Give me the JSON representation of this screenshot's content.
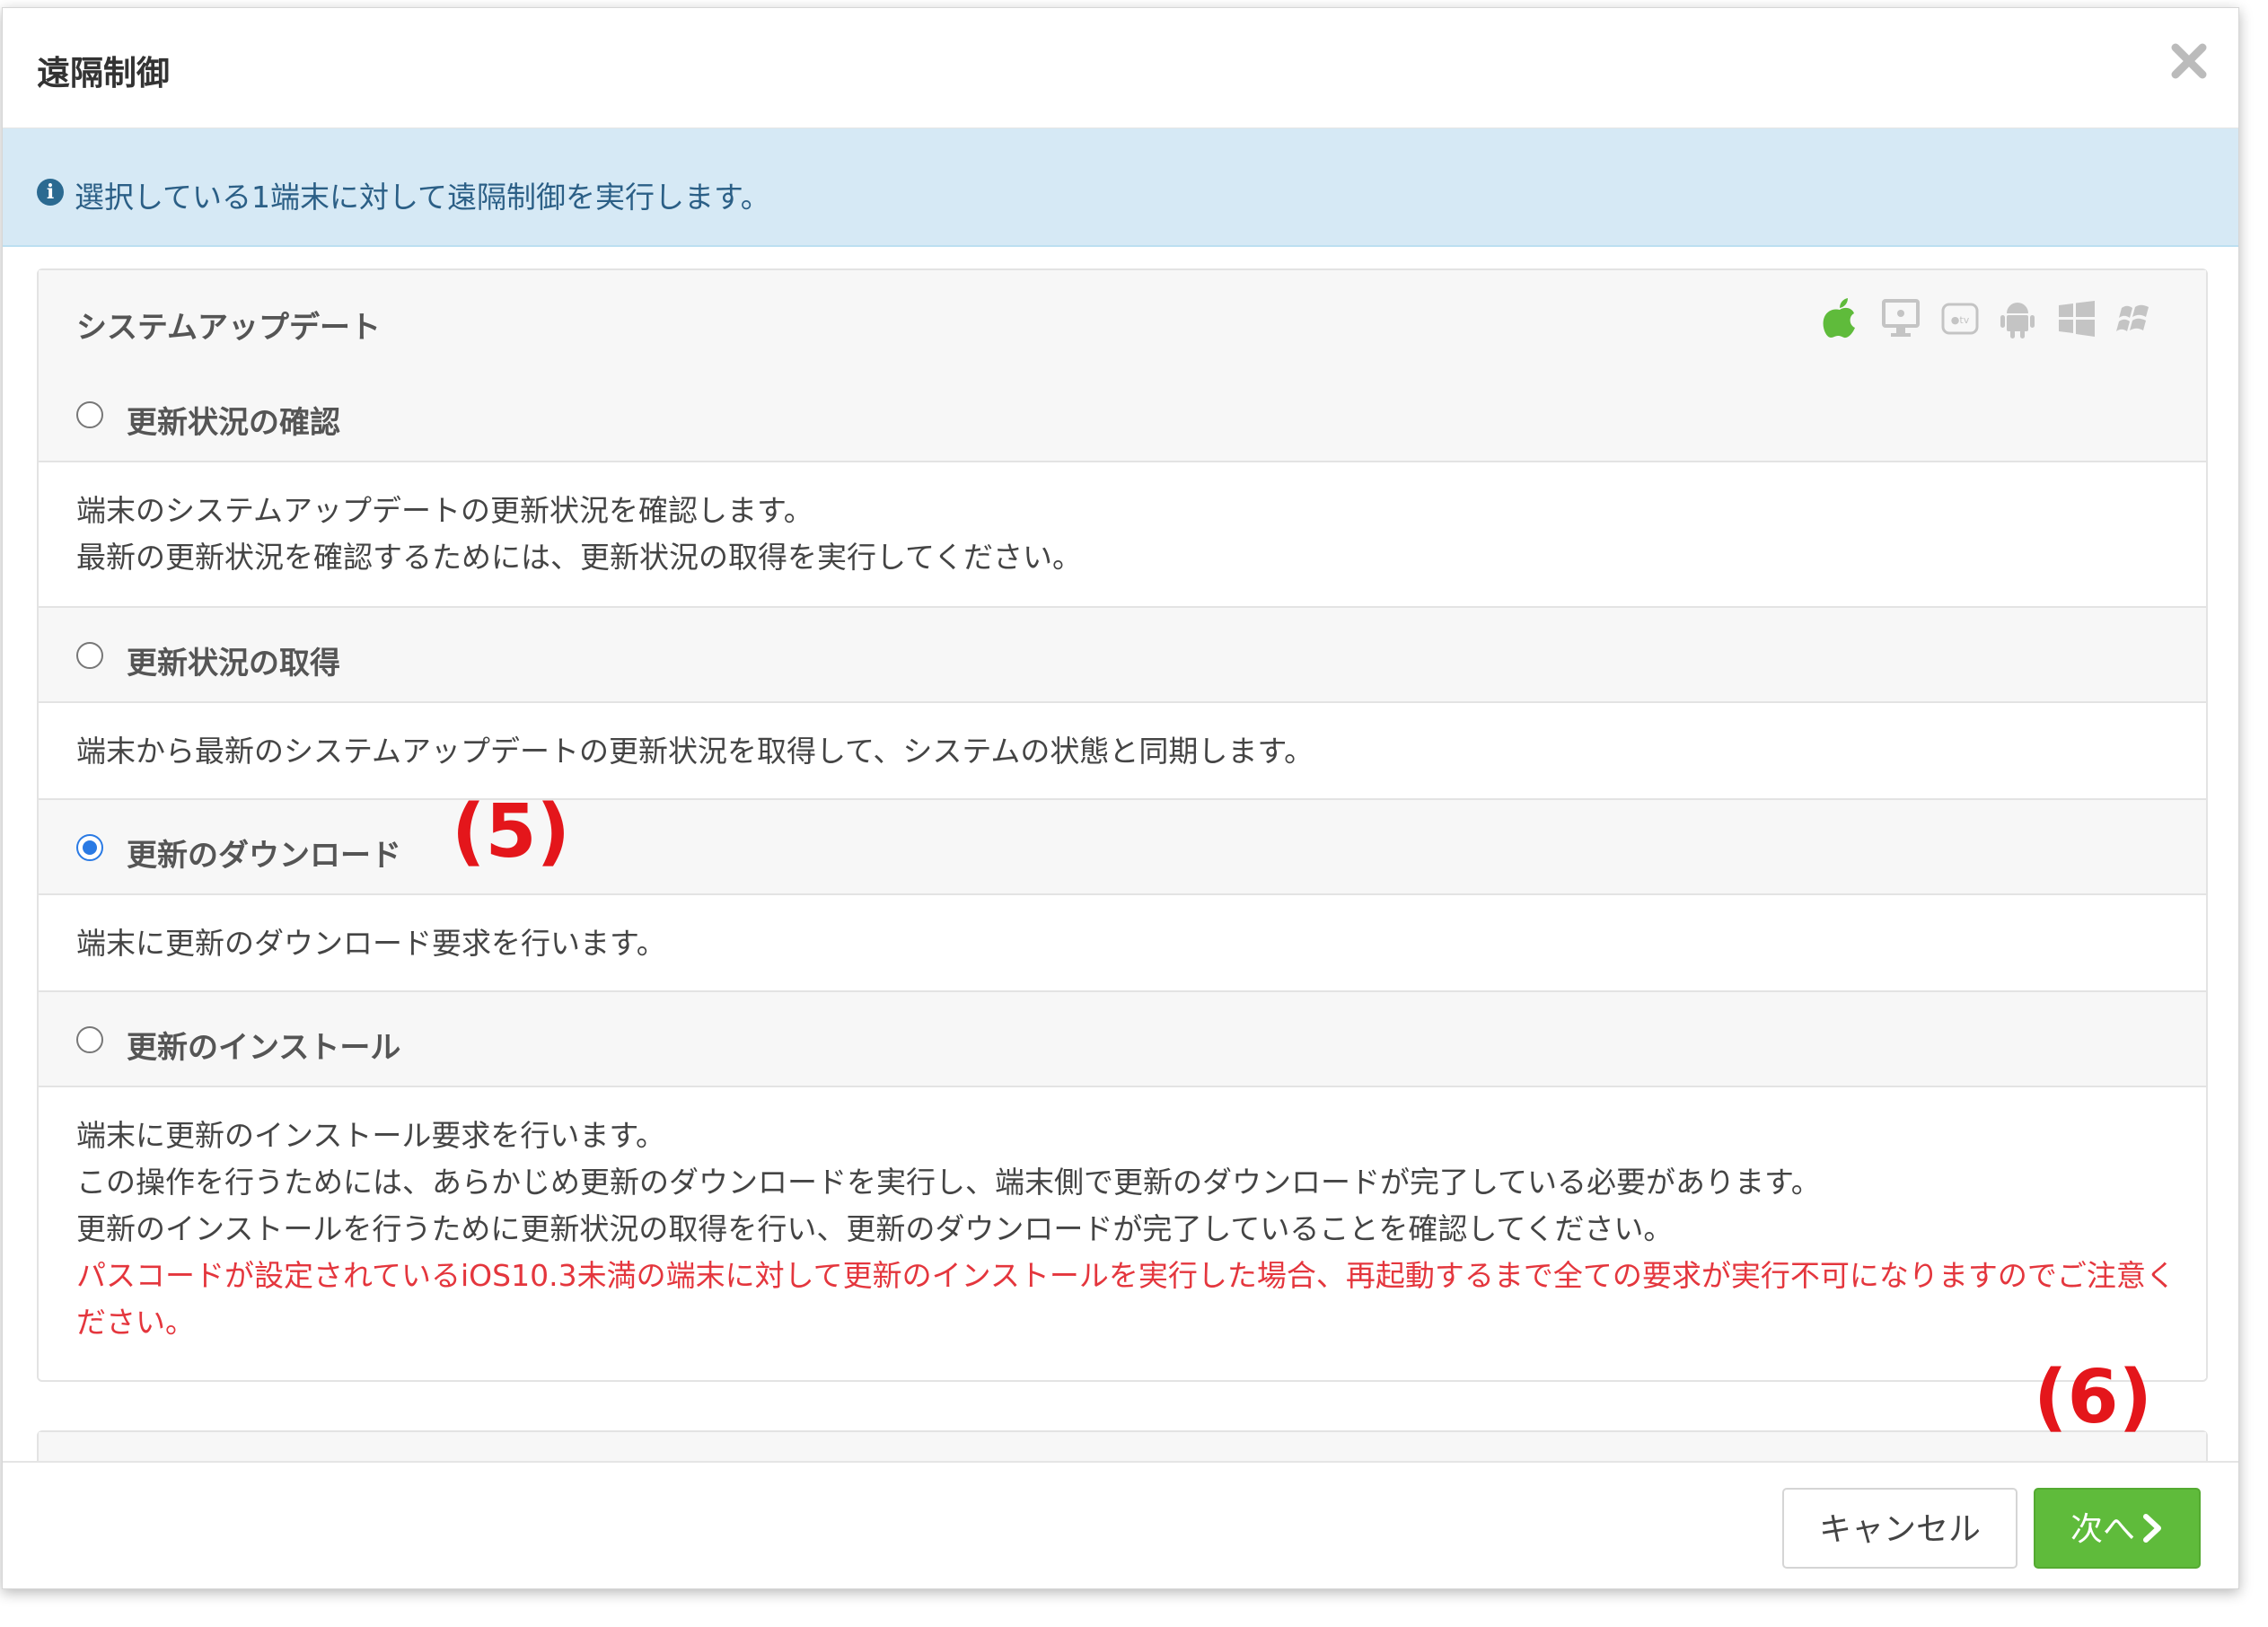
{
  "dialog": {
    "title": "遠隔制御"
  },
  "info": {
    "text": "選択している1端末に対して遠隔制御を実行します。"
  },
  "section": {
    "title": "システムアップデート",
    "os_icons": [
      "apple-icon",
      "mac-icon",
      "apple-tv-icon",
      "android-icon",
      "windows-icon",
      "windows-legacy-icon"
    ],
    "options": [
      {
        "label": "更新状況の確認",
        "selected": false,
        "description": [
          "端末のシステムアップデートの更新状況を確認します。",
          "最新の更新状況を確認するためには、更新状況の取得を実行してください。"
        ]
      },
      {
        "label": "更新状況の取得",
        "selected": false,
        "description": [
          "端末から最新のシステムアップデートの更新状況を取得して、システムの状態と同期します。"
        ]
      },
      {
        "label": "更新のダウンロード",
        "selected": true,
        "description": [
          "端末に更新のダウンロード要求を行います。"
        ]
      },
      {
        "label": "更新のインストール",
        "selected": false,
        "description": [
          "端末に更新のインストール要求を行います。",
          "この操作を行うためには、あらかじめ更新のダウンロードを実行し、端末側で更新のダウンロードが完了している必要があります。",
          "更新のインストールを行うために更新状況の取得を行い、更新のダウンロードが完了していることを確認してください。"
        ],
        "warning": "パスコードが設定されているiOS10.3未満の端末に対して更新のインストールを実行した場合、再起動するまで全ての要求が実行不可になりますのでご注意ください。"
      }
    ]
  },
  "annotations": {
    "step5": "(5)",
    "step6": "(6)"
  },
  "footer": {
    "cancel_label": "キャンセル",
    "next_label": "次へ"
  },
  "colors": {
    "accent_green": "#5fbb3b",
    "info_bg": "#d6e9f5",
    "warning_red": "#e4363d",
    "annotation_red": "#e4161b",
    "radio_blue": "#2a7ae4"
  }
}
